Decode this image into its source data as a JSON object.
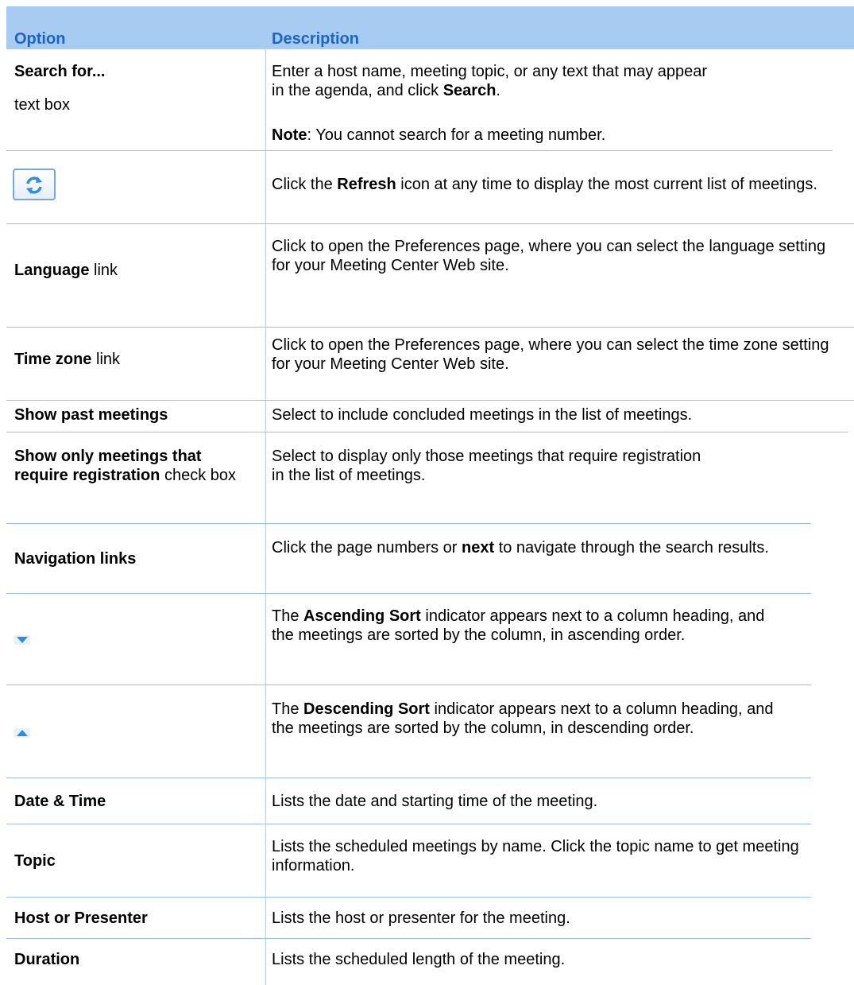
{
  "header": {
    "option": "Option",
    "description": "Description"
  },
  "rows": [
    {
      "option_bold": "Search for...",
      "option_extra": "text box",
      "desc_line1": "Enter a host name, meeting topic, or any text that may appear",
      "desc_line2_pre": "in the agenda, and click ",
      "desc_line2_bold": "Search",
      "desc_line2_post": ".",
      "note_bold": "Note",
      "note_text": ": You cannot search for a meeting number."
    },
    {
      "option_icon": "refresh-icon",
      "desc_pre": "Click the ",
      "desc_bold": "Refresh",
      "desc_post": " icon at any time to display the most current list of meetings."
    },
    {
      "option_bold": "Language",
      "option_post": " link",
      "desc": "Click to open the Preferences page, where you can select the language setting for your Meeting Center Web site."
    },
    {
      "option_bold": "Time zone",
      "option_post": " link",
      "desc": "Click to open the Preferences page, where you can select the time zone setting for your Meeting Center Web site."
    },
    {
      "option_bold": "Show past meetings",
      "desc": "Select to include concluded meetings in the list of meetings."
    },
    {
      "option_bold": "Show only meetings that require registration",
      "option_post": " check box",
      "desc_line1": "Select to display only those meetings that require registration",
      "desc_line2": "in the list of meetings."
    },
    {
      "option_bold": "Navigation links",
      "desc_pre": "Click the page numbers or ",
      "desc_bold": "next",
      "desc_post": " to navigate through the search results."
    },
    {
      "option_icon": "sort-down-icon",
      "desc_pre": "The ",
      "desc_bold": "Ascending Sort",
      "desc_post": " indicator appears next to a column heading, and the meetings are sorted by the column, in ascending order."
    },
    {
      "option_icon": "sort-up-icon",
      "desc_pre": "The ",
      "desc_bold": "Descending Sort",
      "desc_post": " indicator appears next to a column heading, and the meetings are sorted by the column, in descending order."
    },
    {
      "option_bold": "Date & Time",
      "desc": "Lists the date and starting time of the  meeting."
    },
    {
      "option_bold": "Topic",
      "desc": "Lists the scheduled meetings by name. Click the topic name to get meeting information."
    },
    {
      "option_bold": "Host or Presenter",
      "desc": "Lists the host or presenter for the meeting."
    },
    {
      "option_bold": "Duration",
      "desc": "Lists the scheduled length of the meeting."
    }
  ],
  "colors": {
    "header_bg": "#a8cbf2",
    "header_text": "#1a66c8",
    "separator": "#9bbfe6",
    "icon_blue": "#2e8be6"
  }
}
